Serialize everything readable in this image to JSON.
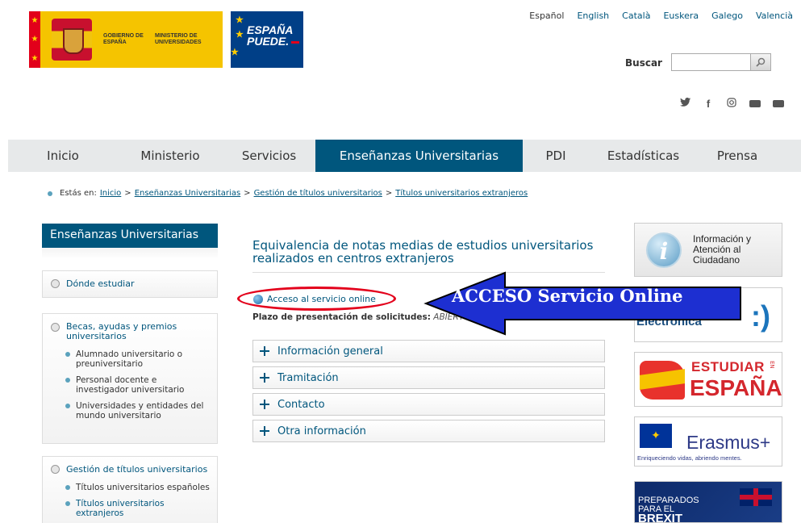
{
  "header": {
    "gobierno_text": "GOBIERNO DE ESPAÑA",
    "ministerio_text": "MINISTERIO DE UNIVERSIDADES",
    "espana_puede_line1": "ESPAÑA",
    "espana_puede_line2": "PUEDE.",
    "languages": [
      "Español",
      "English",
      "Català",
      "Euskera",
      "Galego",
      "Valencià"
    ],
    "search": {
      "label": "Buscar",
      "value": "",
      "button_icon": "search-icon"
    },
    "social_icons": [
      "twitter-icon",
      "facebook-icon",
      "instagram-icon",
      "youtube-icon",
      "flickr-icon"
    ]
  },
  "nav": {
    "items": [
      {
        "label": "Inicio",
        "active": false
      },
      {
        "label": "Ministerio",
        "active": false
      },
      {
        "label": "Servicios",
        "active": false
      },
      {
        "label": "Enseñanzas Universitarias",
        "active": true
      },
      {
        "label": "PDI",
        "active": false
      },
      {
        "label": "Estadísticas",
        "active": false
      },
      {
        "label": "Prensa",
        "active": false
      }
    ]
  },
  "breadcrumb": {
    "prefix": "Estás en:",
    "items": [
      "Inicio",
      "Enseñanzas Universitarias",
      "Gestión de títulos universitarios",
      "Títulos universitarios extranjeros"
    ],
    "separator": ">"
  },
  "sidebar": {
    "title": "Enseñanzas Universitarias",
    "sections": [
      {
        "label": "Dónde estudiar",
        "children": []
      },
      {
        "label": "Becas, ayudas y premios universitarios",
        "children": [
          "Alumnado universitario o preuniversitario",
          "Personal docente e investigador universitario",
          "Universidades y entidades del mundo universitario"
        ]
      },
      {
        "label": "Gestión de títulos universitarios",
        "children": [
          "Títulos universitarios españoles",
          "Títulos universitarios extranjeros"
        ]
      }
    ]
  },
  "main": {
    "title": "Equivalencia de notas medias de estudios universitarios realizados en centros extranjeros",
    "access_link": "Acceso al servicio online",
    "plazo_label": "Plazo de presentación de solicitudes:",
    "plazo_value": "ABIERTO",
    "accordion": [
      "Información general",
      "Tramitación",
      "Contacto",
      "Otra información"
    ]
  },
  "banners": {
    "info": "Información y Atención al Ciudadano",
    "sede": "Electrónica",
    "sede_smile": ":)",
    "estudiar_line1": "ESTUDIAR",
    "estudiar_en": "EN",
    "estudiar_line2": "ESPAÑA",
    "erasmus_word": "Erasmus+",
    "erasmus_sub": "Enriqueciendo vidas, abriendo mentes.",
    "brexit_line1": "PREPARADOS",
    "brexit_line2": "PARA EL",
    "brexit_line3": "BREXIT"
  },
  "annotation": {
    "arrow_label": "ACCESO Servicio Online",
    "ellipse_color": "#e3001b",
    "arrow_fill": "#1d2fd1"
  },
  "colors": {
    "primary": "#00567d",
    "nav_bg": "#e7e9ea"
  }
}
